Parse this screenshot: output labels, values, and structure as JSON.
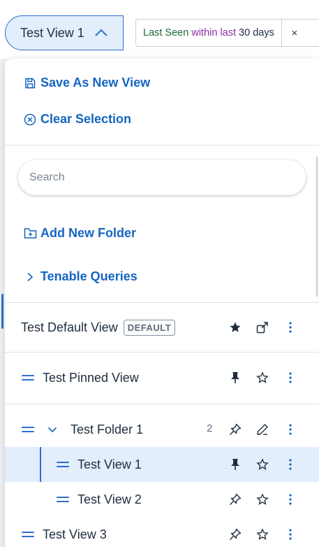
{
  "view_selector": {
    "label": "Test View 1",
    "icon": "chevron-up-icon"
  },
  "filter": {
    "key": "Last Seen",
    "operator": "within last",
    "value": "30 days",
    "remove_label": "×"
  },
  "panel": {
    "save_label": "Save As New View",
    "clear_label": "Clear Selection",
    "search_placeholder": "Search",
    "add_folder_label": "Add New Folder",
    "tenable_queries_label": "Tenable Queries"
  },
  "views": {
    "default_view": {
      "label": "Test Default View",
      "badge": "DEFAULT"
    },
    "pinned_view": {
      "label": "Test Pinned View"
    },
    "folder": {
      "label": "Test Folder 1",
      "count": "2"
    },
    "folder_view_1": {
      "label": "Test View 1"
    },
    "folder_view_2": {
      "label": "Test View 2"
    },
    "view_3": {
      "label": "Test View 3"
    }
  },
  "colors": {
    "accent": "#1565c0",
    "selected_bg": "#e3eefc",
    "filter_key": "#1a6b3c",
    "filter_operator": "#8a2ea0"
  }
}
